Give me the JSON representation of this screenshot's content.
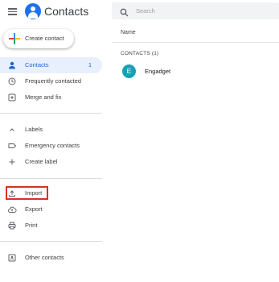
{
  "header": {
    "app_title": "Contacts"
  },
  "create_button": {
    "label": "Create contact"
  },
  "sidebar": {
    "items": [
      {
        "label": "Contacts",
        "count": "1",
        "icon": "person-icon",
        "active": true
      },
      {
        "label": "Frequently contacted",
        "icon": "history-icon"
      },
      {
        "label": "Merge and fix",
        "icon": "merge-icon"
      }
    ],
    "labels_section": {
      "toggle_label": "Labels",
      "items": [
        {
          "label": "Emergency contacts",
          "icon": "label-icon"
        },
        {
          "label": "Create label",
          "icon": "plus-icon"
        }
      ]
    },
    "actions": [
      {
        "label": "Import",
        "icon": "upload-icon"
      },
      {
        "label": "Export",
        "icon": "cloud-icon"
      },
      {
        "label": "Print",
        "icon": "printer-icon"
      }
    ],
    "other": {
      "label": "Other contacts",
      "icon": "other-contacts-icon"
    }
  },
  "search": {
    "placeholder": "Search",
    "value": ""
  },
  "table": {
    "column_header": "Name",
    "section_label": "CONTACTS (1)",
    "rows": [
      {
        "initial": "E",
        "name": "Engadget"
      }
    ]
  },
  "colors": {
    "accent": "#1a73e8",
    "active_bg": "#e8f0fe",
    "avatar": "#12a4b4",
    "highlight": "#d93025"
  }
}
